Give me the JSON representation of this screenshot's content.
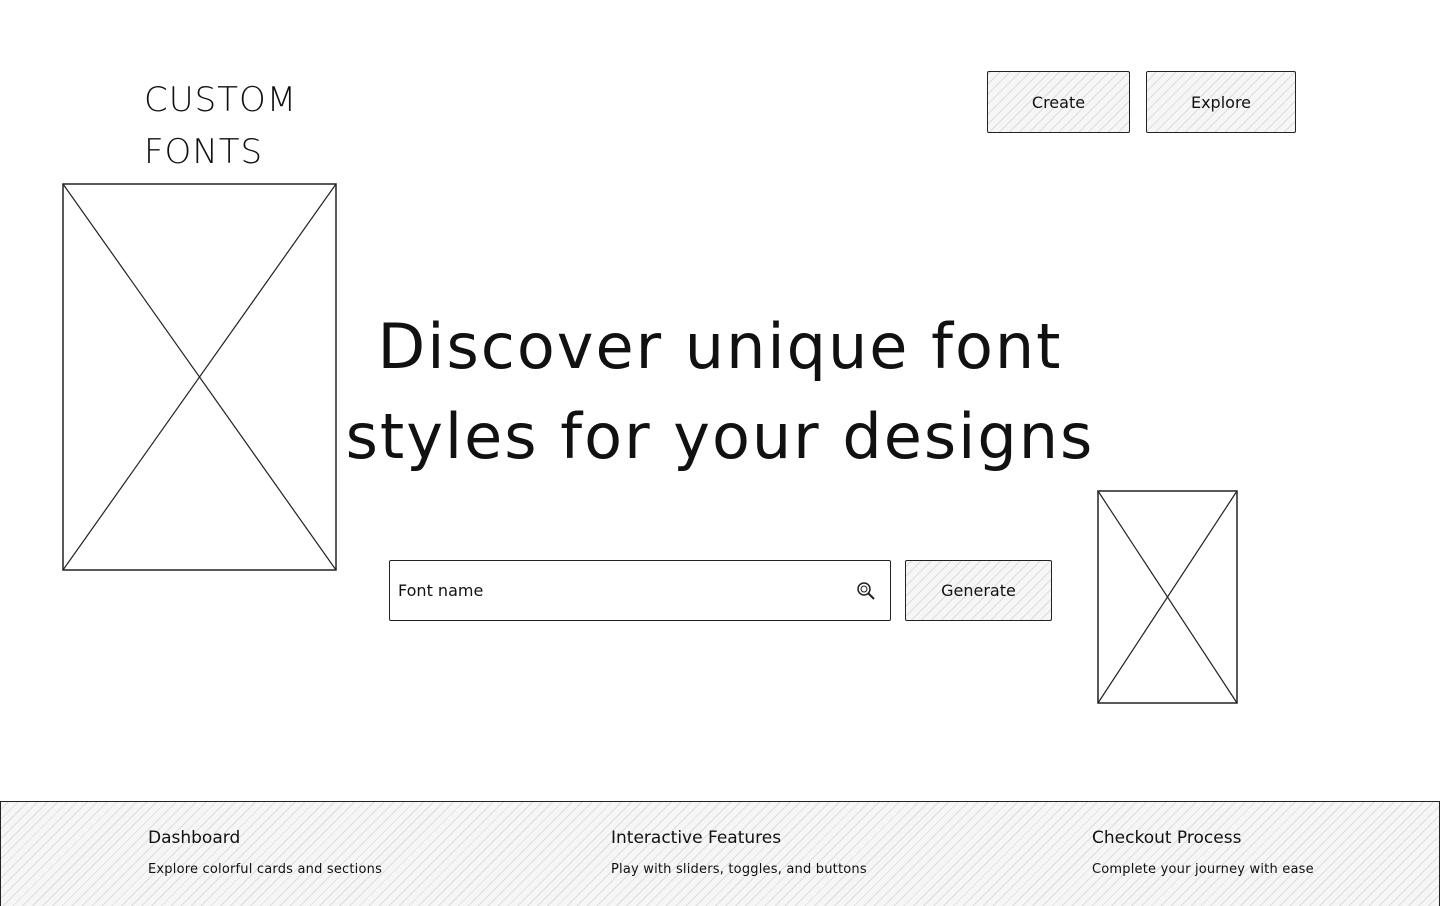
{
  "logo": {
    "line1": "CUSTOM",
    "line2": "FONTS"
  },
  "nav": {
    "create_label": "Create",
    "explore_label": "Explore"
  },
  "hero": {
    "line1": "Discover unique font",
    "line2": "styles for your designs"
  },
  "search": {
    "placeholder": "Font name",
    "icon": "search-icon"
  },
  "generate_label": "Generate",
  "images": {
    "left": "image-placeholder",
    "right": "image-placeholder"
  },
  "footer": {
    "items": [
      {
        "title": "Dashboard",
        "desc": "Explore colorful cards and sections"
      },
      {
        "title": "Interactive Features",
        "desc": "Play with sliders, toggles, and buttons"
      },
      {
        "title": "Checkout Process",
        "desc": "Complete your journey with ease"
      }
    ]
  },
  "colors": {
    "stroke": "#222222",
    "hatch_bg": "#f6f6f6",
    "background": "#ffffff"
  }
}
